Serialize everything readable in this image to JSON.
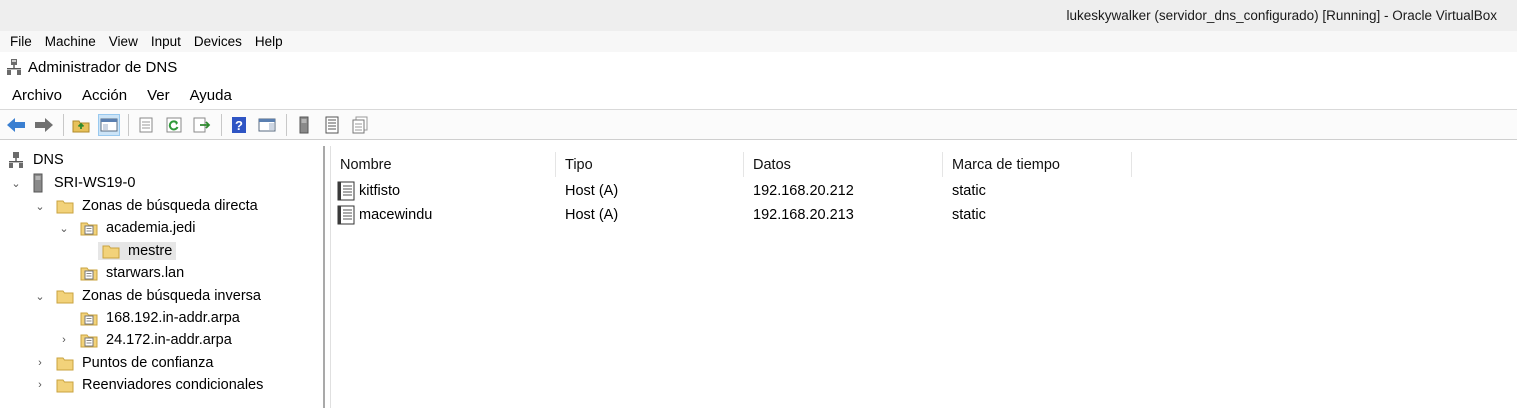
{
  "window": {
    "title": "lukeskywalker (servidor_dns_configurado) [Running] - Oracle VirtualBox"
  },
  "vbox_menu": [
    "File",
    "Machine",
    "View",
    "Input",
    "Devices",
    "Help"
  ],
  "app": {
    "title": "Administrador de DNS",
    "menu": [
      "Archivo",
      "Acción",
      "Ver",
      "Ayuda"
    ]
  },
  "toolbar": {
    "icons": [
      "back-arrow-icon",
      "forward-arrow-icon",
      "up-folder-icon",
      "show-hide-tree-icon",
      "properties-icon",
      "refresh-icon",
      "export-list-icon",
      "help-icon",
      "action-pane-icon",
      "server-icon",
      "new-record-icon",
      "new-records-icon"
    ]
  },
  "tree": {
    "root": "DNS",
    "server": "SRI-WS19-0",
    "forward_zones": "Zonas de búsqueda directa",
    "zone_academia": "academia.jedi",
    "subfolder_mestre": "mestre",
    "zone_starwars": "starwars.lan",
    "reverse_zones": "Zonas de búsqueda inversa",
    "zone_rev1": "168.192.in-addr.arpa",
    "zone_rev2": "24.172.in-addr.arpa",
    "trust_points": "Puntos de confianza",
    "forwarders": "Reenviadores condicionales"
  },
  "list": {
    "columns": [
      "Nombre",
      "Tipo",
      "Datos",
      "Marca de tiempo"
    ],
    "rows": [
      {
        "name": "kitfisto",
        "type": "Host (A)",
        "data": "192.168.20.212",
        "timestamp": "static"
      },
      {
        "name": "macewindu",
        "type": "Host (A)",
        "data": "192.168.20.213",
        "timestamp": "static"
      }
    ]
  }
}
